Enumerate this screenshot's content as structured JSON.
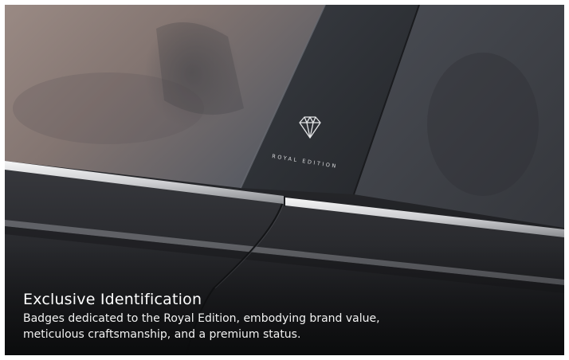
{
  "photo": {
    "subject": "car B-pillar badge",
    "badge_text": "ROYAL EDITION",
    "palette": {
      "window_left": "#8d7b76",
      "window_right": "#3f4248",
      "pillar": "#2c2f34",
      "body": "#2b2c30",
      "chrome": "#e6e7e9"
    }
  },
  "caption": {
    "title": "Exclusive Identification",
    "body": "Badges dedicated to the Royal Edition, embodying brand value,\nmeticulous craftsmanship, and a premium status."
  }
}
